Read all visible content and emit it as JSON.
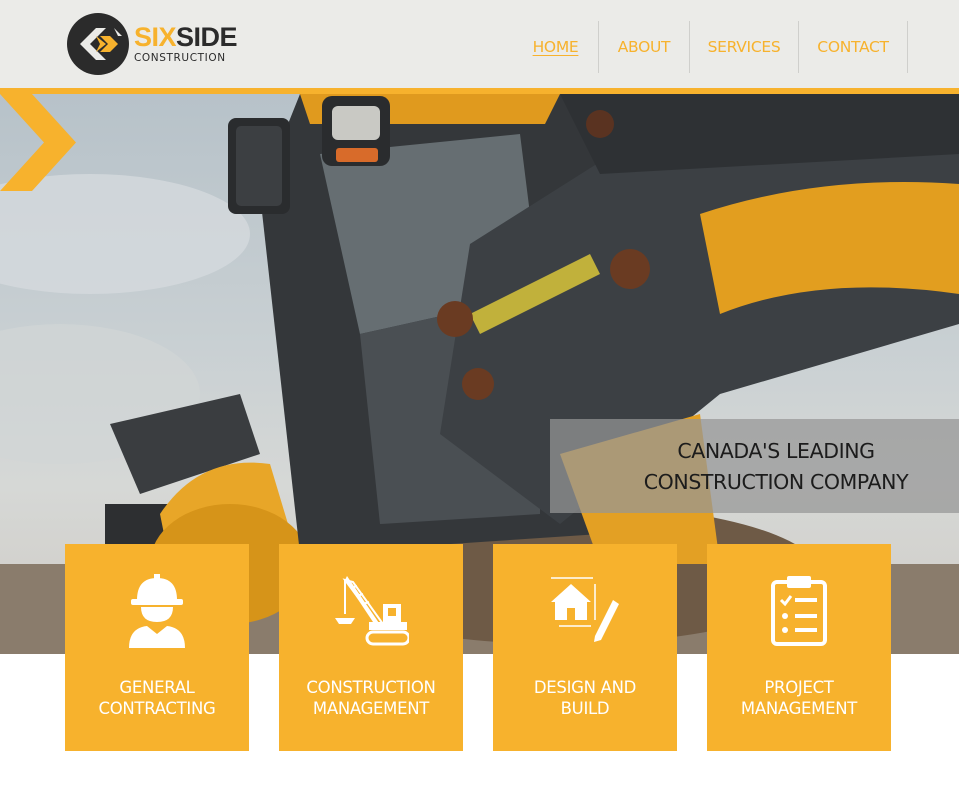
{
  "brand": {
    "name_part1": "SIX",
    "name_part2": "SIDE",
    "tagline": "CONSTRUCTION",
    "accent": "#f7b22d",
    "dark": "#2b2b2b"
  },
  "nav": {
    "items": [
      {
        "label": "HOME",
        "active": true
      },
      {
        "label": "ABOUT",
        "active": false
      },
      {
        "label": "SERVICES",
        "active": false
      },
      {
        "label": "CONTACT",
        "active": false
      }
    ]
  },
  "hero": {
    "headline_line1": "CANADA'S LEADING",
    "headline_line2": "CONSTRUCTION COMPANY",
    "image": "backhoe-loader-photo"
  },
  "services": [
    {
      "line1": "GENERAL",
      "line2": "CONTRACTING",
      "icon": "worker-hardhat-icon"
    },
    {
      "line1": "CONSTRUCTION",
      "line2": "MANAGEMENT",
      "icon": "crane-icon"
    },
    {
      "line1": "DESIGN AND",
      "line2": "BUILD",
      "icon": "house-pencil-icon"
    },
    {
      "line1": "PROJECT",
      "line2": "MANAGEMENT",
      "icon": "clipboard-checklist-icon"
    }
  ]
}
